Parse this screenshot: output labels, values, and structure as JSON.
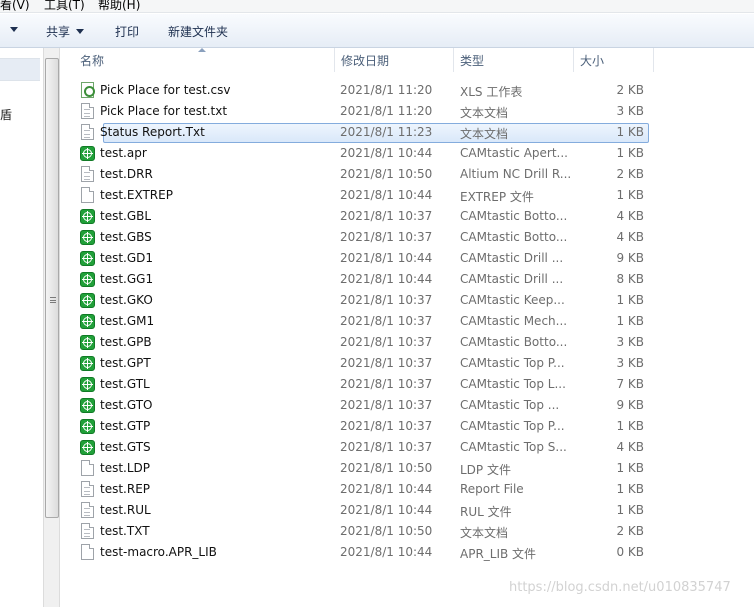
{
  "menubar": {
    "view": "看(V)",
    "tools": "工具(T)",
    "help": "帮助(H)"
  },
  "toolbar": {
    "share": "共享",
    "print": "打印",
    "new_folder": "新建文件夹"
  },
  "nav": {
    "partial_glyph": "盾"
  },
  "columns": {
    "name": "名称",
    "date": "修改日期",
    "type": "类型",
    "size": "大小"
  },
  "files": [
    {
      "name": "Pick Place for test.csv",
      "date": "2021/8/1 11:20",
      "type": "XLS 工作表",
      "size": "2 KB",
      "icon": "xls-icon"
    },
    {
      "name": "Pick Place for test.txt",
      "date": "2021/8/1 11:20",
      "type": "文本文档",
      "size": "3 KB",
      "icon": "text-file-icon"
    },
    {
      "name": "Status Report.Txt",
      "date": "2021/8/1 11:23",
      "type": "文本文档",
      "size": "1 KB",
      "icon": "text-file-icon"
    },
    {
      "name": "test.apr",
      "date": "2021/8/1 10:44",
      "type": "CAMtastic Apert...",
      "size": "1 KB",
      "icon": "camtastic-icon"
    },
    {
      "name": "test.DRR",
      "date": "2021/8/1 10:50",
      "type": "Altium NC Drill R...",
      "size": "2 KB",
      "icon": "text-file-icon"
    },
    {
      "name": "test.EXTREP",
      "date": "2021/8/1 10:44",
      "type": "EXTREP 文件",
      "size": "1 KB",
      "icon": "blank-file-icon"
    },
    {
      "name": "test.GBL",
      "date": "2021/8/1 10:37",
      "type": "CAMtastic Botto...",
      "size": "4 KB",
      "icon": "camtastic-icon"
    },
    {
      "name": "test.GBS",
      "date": "2021/8/1 10:37",
      "type": "CAMtastic Botto...",
      "size": "4 KB",
      "icon": "camtastic-icon"
    },
    {
      "name": "test.GD1",
      "date": "2021/8/1 10:44",
      "type": "CAMtastic Drill ...",
      "size": "9 KB",
      "icon": "camtastic-icon"
    },
    {
      "name": "test.GG1",
      "date": "2021/8/1 10:44",
      "type": "CAMtastic Drill ...",
      "size": "8 KB",
      "icon": "camtastic-icon"
    },
    {
      "name": "test.GKO",
      "date": "2021/8/1 10:37",
      "type": "CAMtastic Keep...",
      "size": "1 KB",
      "icon": "camtastic-icon"
    },
    {
      "name": "test.GM1",
      "date": "2021/8/1 10:37",
      "type": "CAMtastic Mech...",
      "size": "1 KB",
      "icon": "camtastic-icon"
    },
    {
      "name": "test.GPB",
      "date": "2021/8/1 10:37",
      "type": "CAMtastic Botto...",
      "size": "3 KB",
      "icon": "camtastic-icon"
    },
    {
      "name": "test.GPT",
      "date": "2021/8/1 10:37",
      "type": "CAMtastic Top P...",
      "size": "3 KB",
      "icon": "camtastic-icon"
    },
    {
      "name": "test.GTL",
      "date": "2021/8/1 10:37",
      "type": "CAMtastic Top L...",
      "size": "7 KB",
      "icon": "camtastic-icon"
    },
    {
      "name": "test.GTO",
      "date": "2021/8/1 10:37",
      "type": "CAMtastic Top ...",
      "size": "9 KB",
      "icon": "camtastic-icon"
    },
    {
      "name": "test.GTP",
      "date": "2021/8/1 10:37",
      "type": "CAMtastic Top P...",
      "size": "1 KB",
      "icon": "camtastic-icon"
    },
    {
      "name": "test.GTS",
      "date": "2021/8/1 10:37",
      "type": "CAMtastic Top S...",
      "size": "4 KB",
      "icon": "camtastic-icon"
    },
    {
      "name": "test.LDP",
      "date": "2021/8/1 10:50",
      "type": "LDP 文件",
      "size": "1 KB",
      "icon": "blank-file-icon"
    },
    {
      "name": "test.REP",
      "date": "2021/8/1 10:44",
      "type": "Report File",
      "size": "1 KB",
      "icon": "text-file-icon"
    },
    {
      "name": "test.RUL",
      "date": "2021/8/1 10:44",
      "type": "RUL 文件",
      "size": "1 KB",
      "icon": "text-file-icon"
    },
    {
      "name": "test.TXT",
      "date": "2021/8/1 10:50",
      "type": "文本文档",
      "size": "2 KB",
      "icon": "text-file-icon"
    },
    {
      "name": "test-macro.APR_LIB",
      "date": "2021/8/1 10:44",
      "type": "APR_LIB 文件",
      "size": "0 KB",
      "icon": "blank-file-icon"
    }
  ],
  "selected_index": 2,
  "watermark": "https://blog.csdn.net/u010835747"
}
